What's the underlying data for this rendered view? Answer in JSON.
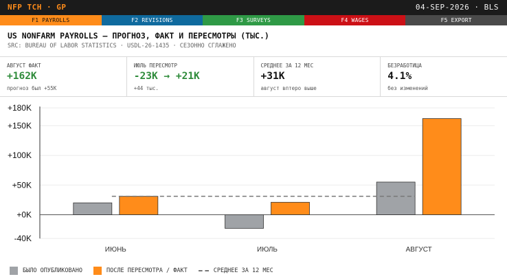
{
  "header": {
    "brand": "NFP TCH · GP",
    "date": "04-SEP-2026 · BLS"
  },
  "tabs": [
    {
      "label": "F1 PAYROLLS",
      "color": "#ff8c1a"
    },
    {
      "label": "F2 REVISIONS",
      "color": "#0f6a9e"
    },
    {
      "label": "F3 SURVEYS",
      "color": "#2f9a46"
    },
    {
      "label": "F4 WAGES",
      "color": "#cc1016"
    },
    {
      "label": "F5 EXPORT",
      "color": "#4a4a4a"
    }
  ],
  "title": "US NONFARM PAYROLLS — ПРОГНОЗ, ФАКТ И ПЕРЕСМОТРЫ (ТЫС.)",
  "subtitle": "SRC: BUREAU OF LABOR STATISTICS · USDL-26-1435 · СЕЗОННО СГЛАЖЕНО",
  "metrics": [
    {
      "label": "АВГУСТ ФАКТ",
      "value": "+162K",
      "note": "прогноз был +55K"
    },
    {
      "label": "ИЮЛЬ ПЕРЕСМОТР",
      "value": "-23K → +21K",
      "note": "+44 тыс."
    },
    {
      "label": "СРЕДНЕЕ ЗА 12 МЕС",
      "value": "+31K",
      "note": "август вптеро выше"
    },
    {
      "label": "БЕЗРАБОТИЦА",
      "value": "4.1%",
      "note": "без изменений"
    }
  ],
  "legend": {
    "published": "БЫЛО ОПУБЛИКОВАНО",
    "revised": "ПОСЛЕ ПЕРЕСМОТРА / ФАКТ",
    "average": "СРЕДНЕЕ ЗА 12 МЕС"
  },
  "chart_data": {
    "type": "bar",
    "categories": [
      "ИЮНЬ",
      "ИЮЛЬ",
      "АВГУСТ"
    ],
    "series": [
      {
        "name": "БЫЛО ОПУБЛИКОВАНО",
        "color": "#a0a3a7",
        "values": [
          20,
          -23,
          55
        ]
      },
      {
        "name": "ПОСЛЕ ПЕРЕСМОТРА / ФАКТ",
        "color": "#ff8c1a",
        "values": [
          31,
          21,
          162
        ]
      }
    ],
    "reference_line": {
      "name": "СРЕДНЕЕ ЗА 12 МЕС",
      "value": 31,
      "style": "dashed"
    },
    "yticks": [
      -40,
      0,
      50,
      100,
      150,
      180
    ],
    "ytick_labels": [
      "-40K",
      "+0K",
      "+50K",
      "+100K",
      "+150K",
      "+180K"
    ],
    "ylim": [
      -40,
      180
    ],
    "grid": true
  }
}
